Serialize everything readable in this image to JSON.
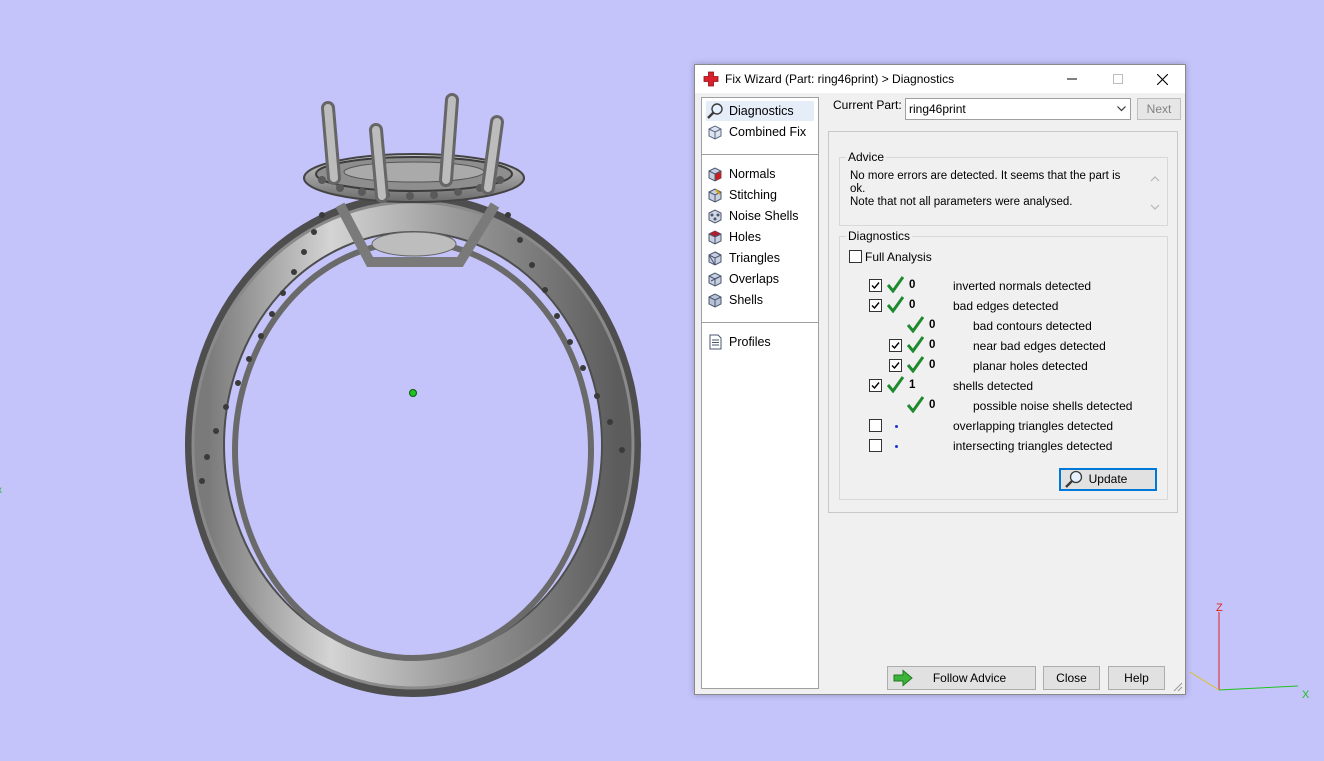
{
  "dialog": {
    "title": "Fix Wizard (Part: ring46print) > Diagnostics"
  },
  "nav": {
    "items": [
      {
        "label": "Diagnostics",
        "icon": "magnifier-icon"
      },
      {
        "label": "Combined Fix",
        "icon": "cube-wire-icon"
      },
      {
        "label": "Normals",
        "icon": "normals-cube-icon"
      },
      {
        "label": "Stitching",
        "icon": "stitching-cube-icon"
      },
      {
        "label": "Noise Shells",
        "icon": "noise-shells-icon"
      },
      {
        "label": "Holes",
        "icon": "holes-cube-icon"
      },
      {
        "label": "Triangles",
        "icon": "triangles-cube-icon"
      },
      {
        "label": "Overlaps",
        "icon": "overlaps-cube-icon"
      },
      {
        "label": "Shells",
        "icon": "shells-cube-icon"
      },
      {
        "label": "Profiles",
        "icon": "document-icon"
      }
    ],
    "selected": "Diagnostics"
  },
  "current_part": {
    "label": "Current Part:",
    "value": "ring46print",
    "next_label": "Next"
  },
  "advice": {
    "title": "Advice",
    "line1": "No more errors are detected. It seems that the part is ok.",
    "line2": "Note that not all parameters were analysed."
  },
  "diagnostics": {
    "title": "Diagnostics",
    "full_analysis_label": "Full Analysis",
    "rows": [
      {
        "count": "0",
        "label": "inverted normals detected"
      },
      {
        "count": "0",
        "label": "bad edges detected"
      },
      {
        "count": "0",
        "label": "bad contours detected"
      },
      {
        "count": "0",
        "label": "near bad edges detected"
      },
      {
        "count": "0",
        "label": "planar holes detected"
      },
      {
        "count": "1",
        "label": "shells detected"
      },
      {
        "count": "0",
        "label": "possible noise shells detected"
      },
      {
        "count": "",
        "label": "overlapping triangles detected"
      },
      {
        "count": "",
        "label": "intersecting triangles detected"
      }
    ],
    "update_label": "Update"
  },
  "buttons": {
    "follow_advice": "Follow Advice",
    "close": "Close",
    "help": "Help"
  },
  "axes": {
    "z": "Z",
    "x": "X"
  },
  "colors": {
    "viewport_background": "#c4c4fb",
    "check_green": "#1e8a2e",
    "axis_red": "#e0241c",
    "axis_green": "#22c022"
  }
}
